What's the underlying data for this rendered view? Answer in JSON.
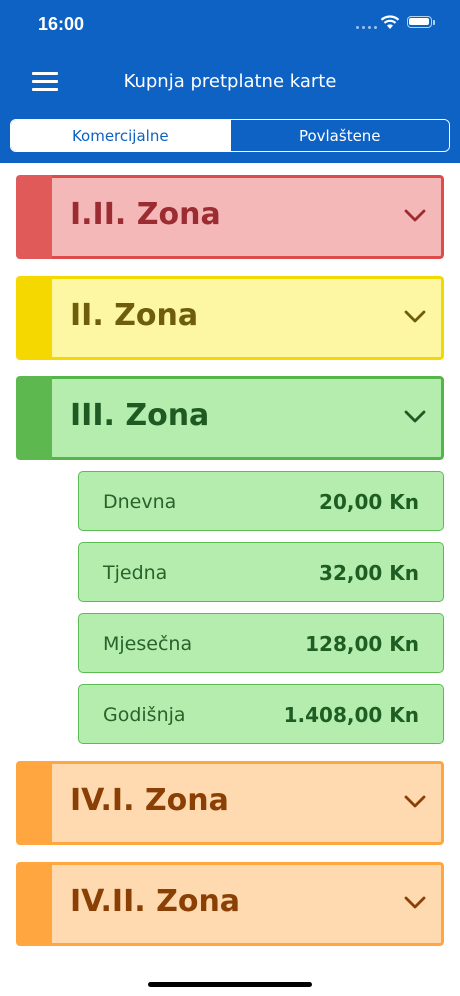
{
  "status_bar": {
    "time": "16:00"
  },
  "nav": {
    "title": "Kupnja pretplatne karte"
  },
  "tabs": [
    {
      "label": "Komercijalne",
      "selected": true
    },
    {
      "label": "Povlaštene",
      "selected": false
    }
  ],
  "zones": [
    {
      "label": "I.II. Zona",
      "stripe": "#e05a5a",
      "fill": "#f5b8b8",
      "border": "#de4b4b",
      "text": "#9b2c31",
      "expanded": false
    },
    {
      "label": "II. Zona",
      "stripe": "#f5d800",
      "fill": "#fdf6a2",
      "border": "#f2d900",
      "text": "#6e5d0b",
      "expanded": false
    },
    {
      "label": "III. Zona",
      "stripe": "#5cb84f",
      "fill": "#b5edaf",
      "border": "#55b548",
      "text": "#1f5a22",
      "expanded": true,
      "items": [
        {
          "name": "Dnevna",
          "price": "20,00 Kn"
        },
        {
          "name": "Tjedna",
          "price": "32,00 Kn"
        },
        {
          "name": "Mjesečna",
          "price": "128,00 Kn"
        },
        {
          "name": "Godišnja",
          "price": "1.408,00 Kn"
        }
      ]
    },
    {
      "label": "IV.I. Zona",
      "stripe": "#ffa640",
      "fill": "#ffd9b0",
      "border": "#ffa640",
      "text": "#8a4005",
      "expanded": false
    },
    {
      "label": "IV.II. Zona",
      "stripe": "#ffa640",
      "fill": "#ffd9b0",
      "border": "#ffa640",
      "text": "#8a4005",
      "expanded": false
    }
  ]
}
